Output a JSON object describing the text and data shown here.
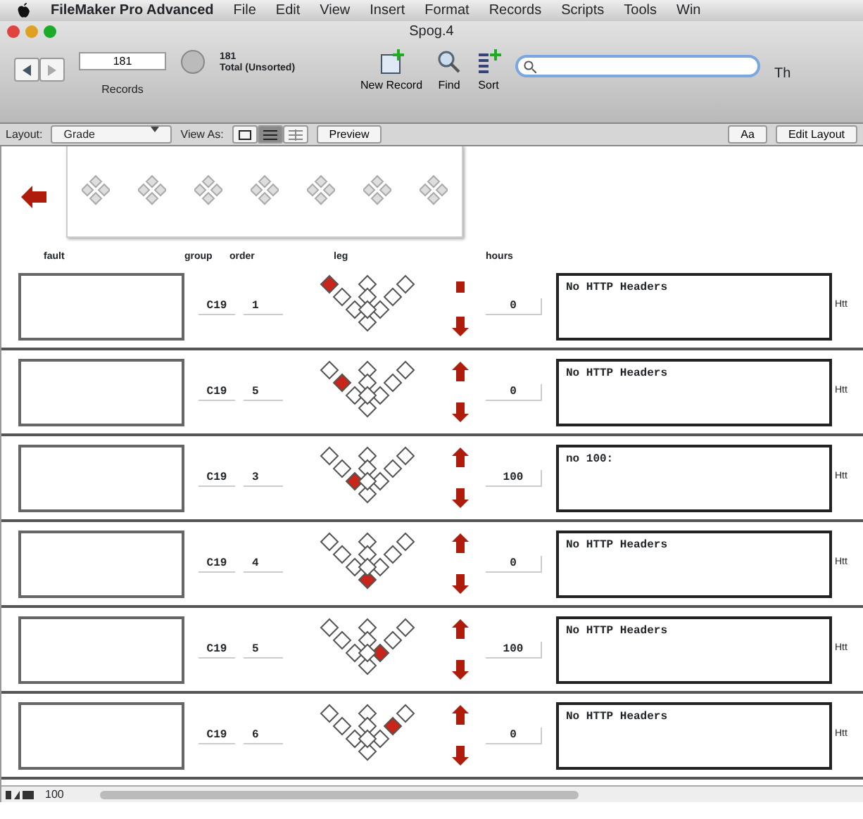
{
  "menu_bar": {
    "app": "FileMaker Pro Advanced",
    "items": [
      "File",
      "Edit",
      "View",
      "Insert",
      "Format",
      "Records",
      "Scripts",
      "Tools",
      "Win"
    ]
  },
  "window": {
    "title": "Spog.4"
  },
  "toolbar": {
    "record_number": "181",
    "found": "181",
    "total": "Total (Unsorted)",
    "records_label": "Records",
    "buttons": [
      "New Record",
      "Find",
      "Sort"
    ],
    "zoom_cut": "Th"
  },
  "layout_bar": {
    "layout_label": "Layout:",
    "layout": "Grade",
    "view_as_label": "View As:",
    "views": [
      {
        "kind": "form",
        "selected": false
      },
      {
        "kind": "list",
        "selected": true
      },
      {
        "kind": "table",
        "selected": false
      }
    ],
    "preview": "Preview",
    "aa": "Aa",
    "edit_layout": "Edit Layout"
  },
  "columns": [
    "fault",
    "group",
    "order",
    "leg",
    "hours"
  ],
  "rows": [
    {
      "group": "C19",
      "order": "1",
      "hours": "0",
      "note": "No HTTP Headers",
      "side": "Htt",
      "pegs": [
        true,
        false,
        false,
        false,
        false,
        false,
        false,
        false,
        false,
        false
      ],
      "up_arrow": false
    },
    {
      "group": "C19",
      "order": "5",
      "hours": "0",
      "note": "No HTTP Headers",
      "side": "Htt",
      "pegs": [
        false,
        true,
        false,
        false,
        false,
        false,
        false,
        false,
        false,
        false
      ],
      "up_arrow": true
    },
    {
      "group": "C19",
      "order": "3",
      "hours": "100",
      "note": "no 100:",
      "side": "Htt",
      "pegs": [
        false,
        false,
        true,
        false,
        false,
        false,
        false,
        false,
        false,
        false
      ],
      "up_arrow": true
    },
    {
      "group": "C19",
      "order": "4",
      "hours": "0",
      "note": "No HTTP Headers",
      "side": "Htt",
      "pegs": [
        false,
        false,
        false,
        true,
        false,
        false,
        false,
        false,
        false,
        false
      ],
      "up_arrow": true
    },
    {
      "group": "C19",
      "order": "5",
      "hours": "100",
      "note": "No HTTP Headers",
      "side": "Htt",
      "pegs": [
        false,
        false,
        false,
        false,
        true,
        false,
        false,
        false,
        false,
        false
      ],
      "up_arrow": true
    },
    {
      "group": "C19",
      "order": "6",
      "hours": "0",
      "note": "No HTTP Headers",
      "side": "Htt",
      "pegs": [
        false,
        false,
        false,
        false,
        false,
        true,
        false,
        false,
        false,
        false
      ],
      "up_arrow": true
    }
  ],
  "status_bar": {
    "zoom": "100"
  }
}
